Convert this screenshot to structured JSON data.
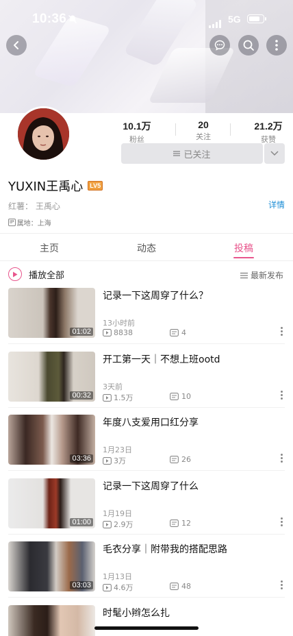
{
  "status_bar": {
    "time": "10:36",
    "network": "5G"
  },
  "profile": {
    "stats": [
      {
        "value": "10.1万",
        "label": "粉丝"
      },
      {
        "value": "20",
        "label": "关注"
      },
      {
        "value": "21.2万",
        "label": "获赞"
      }
    ],
    "follow_label": "已关注",
    "name": "YUXIN王禹心",
    "level_badge": "LV5",
    "honor_label": "红薯：",
    "honor_value": "王禹心",
    "detail_link": "详情",
    "ip_tag": "IP",
    "ip_text": "属地：上海"
  },
  "tabs": [
    {
      "label": "主页",
      "active": false
    },
    {
      "label": "动态",
      "active": false
    },
    {
      "label": "投稿",
      "active": true
    }
  ],
  "list_header": {
    "play_all": "播放全部",
    "sort": "最新发布"
  },
  "videos": [
    {
      "title": "记录一下这周穿了什么？",
      "date": "13小时前",
      "duration": "01:02",
      "views": "8838",
      "comments": "4"
    },
    {
      "title": "开工第一天｜不想上班ootd",
      "date": "3天前",
      "duration": "00:32",
      "views": "1.5万",
      "comments": "10"
    },
    {
      "title": "年度八支爱用口红分享",
      "date": "1月23日",
      "duration": "03:36",
      "views": "3万",
      "comments": "26"
    },
    {
      "title": "记录一下这周穿了什么",
      "date": "1月19日",
      "duration": "01:00",
      "views": "2.9万",
      "comments": "12"
    },
    {
      "title": "毛衣分享｜附带我的搭配思路",
      "date": "1月13日",
      "duration": "03:03",
      "views": "4.6万",
      "comments": "48"
    },
    {
      "title": "时髦小辫怎么扎"
    }
  ],
  "colors": {
    "accent": "#e8558c",
    "link": "#1e8ed6"
  }
}
